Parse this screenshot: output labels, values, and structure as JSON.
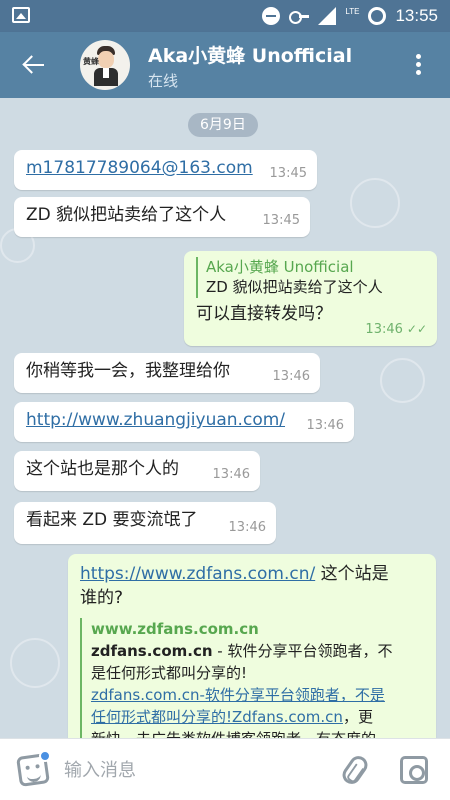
{
  "status_bar": {
    "time": "13:55",
    "network": "LTE"
  },
  "header": {
    "title": "Aka小黄蜂 Unofficial",
    "status": "在线",
    "avatar_badge": "黄蜂"
  },
  "date_label": "6月9日",
  "messages": [
    {
      "direction": "in",
      "text": "m17817789064@163.com",
      "time": "13:45"
    },
    {
      "direction": "in",
      "text": "ZD 貌似把站卖给了这个人",
      "time": "13:45"
    },
    {
      "direction": "out",
      "reply_author": "Aka小黄蜂 Unofficial",
      "reply_text": "ZD 貌似把站卖给了这个人",
      "text": "可以直接转发吗？",
      "time": "13:46",
      "ticks": "✓✓"
    },
    {
      "direction": "in",
      "text": "你稍等我一会，我整理给你",
      "time": "13:46"
    },
    {
      "direction": "in",
      "text": "http://www.zhuangjiyuan.com/",
      "time": "13:46"
    },
    {
      "direction": "in",
      "text": "这个站也是那个人的",
      "time": "13:46"
    },
    {
      "direction": "in",
      "text": "看起来 ZD 要变流氓了",
      "time": "13:46"
    },
    {
      "direction": "out",
      "link": "https://www.zdfans.com.cn/",
      "text_line1": " 这个站是",
      "text_line2": "谁的?",
      "preview_site": "www.zdfans.com.cn",
      "preview_title": "zdfans.com.cn",
      "preview_title_rest": " - 软件分享平台领跑者，不",
      "preview_line2": "是任何形式都叫分享的!",
      "preview_link_line1": "zdfans.com.cn-软件分享平台领跑者，不是",
      "preview_link_line2": "任何形式都叫分享的!Zdfans.com.cn",
      "preview_more": "，更",
      "preview_cut": "新快，去广告类软件博客领跑者。有态度的"
    }
  ],
  "input": {
    "placeholder": "输入消息"
  }
}
